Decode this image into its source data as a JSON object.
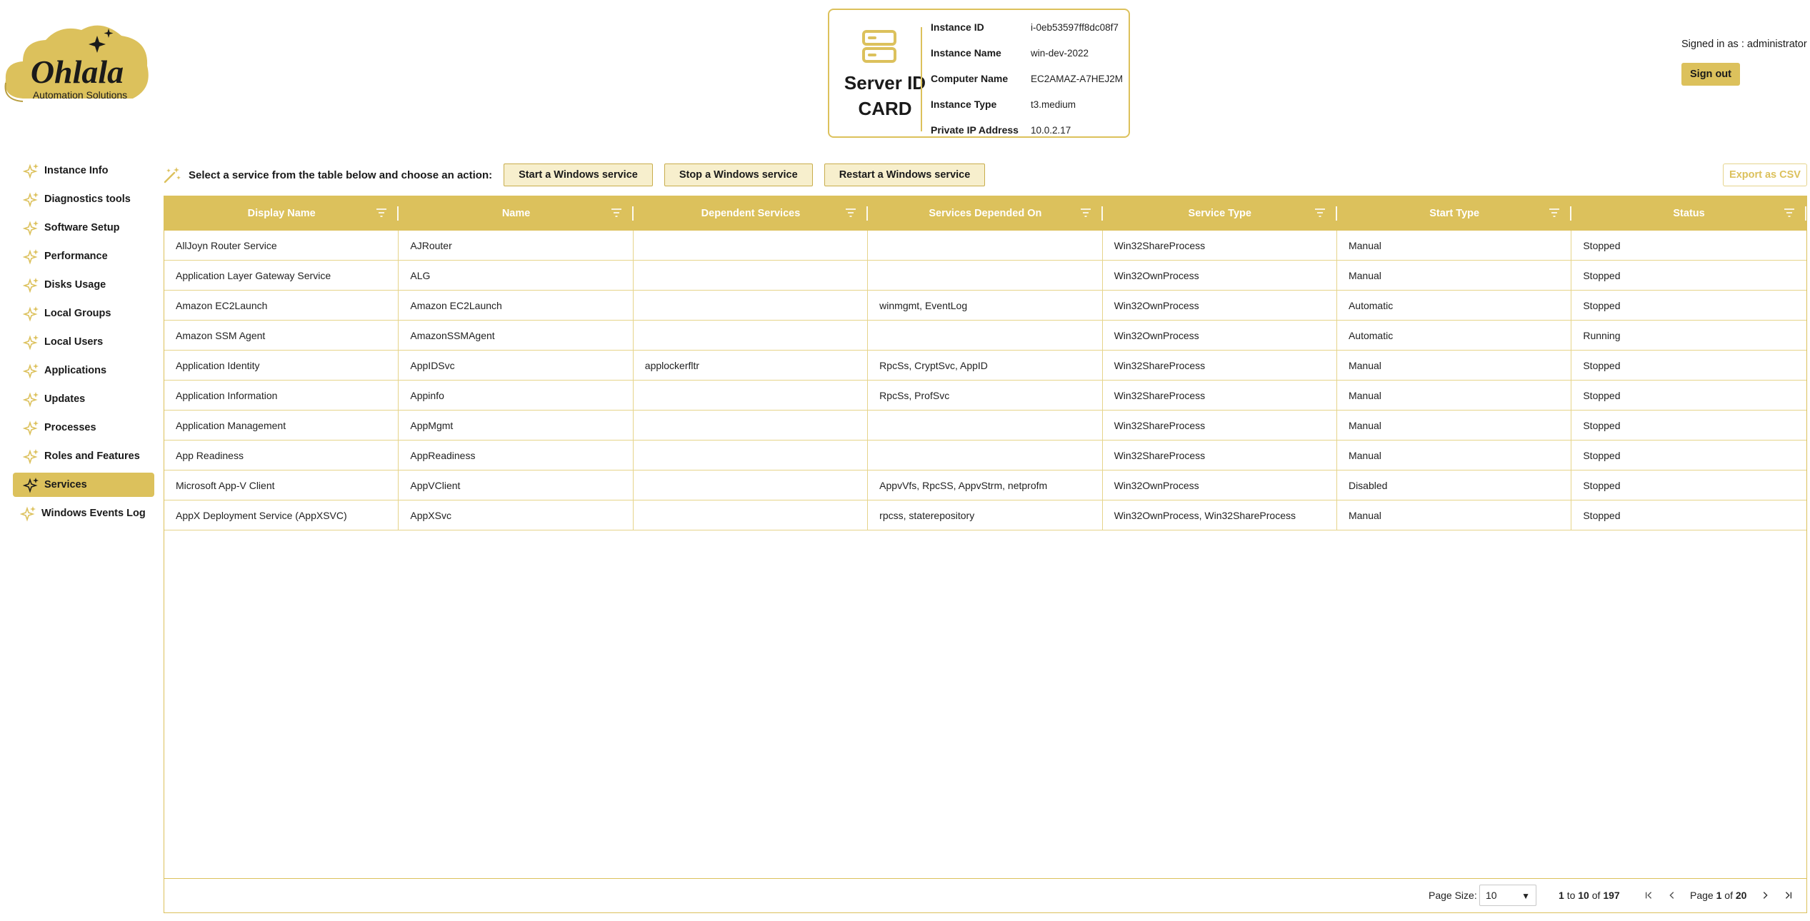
{
  "logo": {
    "brand": "Ohlala",
    "tagline": "Automation Solutions"
  },
  "id_card": {
    "title_line1": "Server ID",
    "title_line2": "CARD",
    "fields": [
      {
        "label": "Instance ID",
        "value": "i-0eb53597ff8dc08f7"
      },
      {
        "label": "Instance Name",
        "value": "win-dev-2022"
      },
      {
        "label": "Computer Name",
        "value": "EC2AMAZ-A7HEJ2M"
      },
      {
        "label": "Instance Type",
        "value": "t3.medium"
      },
      {
        "label": "Private IP Address",
        "value": "10.0.2.17"
      }
    ]
  },
  "user": {
    "signed_in": "Signed in as : administrator",
    "sign_out": "Sign out"
  },
  "sidebar": {
    "items": [
      {
        "label": "Instance Info"
      },
      {
        "label": "Diagnostics tools"
      },
      {
        "label": "Software Setup"
      },
      {
        "label": "Performance"
      },
      {
        "label": "Disks Usage"
      },
      {
        "label": "Local Groups"
      },
      {
        "label": "Local Users"
      },
      {
        "label": "Applications"
      },
      {
        "label": "Updates"
      },
      {
        "label": "Processes"
      },
      {
        "label": "Roles and Features"
      },
      {
        "label": "Services",
        "active": true
      },
      {
        "label": "Windows Events Log"
      }
    ]
  },
  "actions": {
    "prompt": "Select a service from the table below and choose an action:",
    "start": "Start a Windows service",
    "stop": "Stop a Windows service",
    "restart": "Restart a Windows service",
    "export": "Export as CSV"
  },
  "table": {
    "columns": [
      "Display Name",
      "Name",
      "Dependent Services",
      "Services Depended On",
      "Service Type",
      "Start Type",
      "Status"
    ],
    "rows": [
      [
        "AllJoyn Router Service",
        "AJRouter",
        "",
        "",
        "Win32ShareProcess",
        "Manual",
        "Stopped"
      ],
      [
        "Application Layer Gateway Service",
        "ALG",
        "",
        "",
        "Win32OwnProcess",
        "Manual",
        "Stopped"
      ],
      [
        "Amazon EC2Launch",
        "Amazon EC2Launch",
        "",
        "winmgmt, EventLog",
        "Win32OwnProcess",
        "Automatic",
        "Stopped"
      ],
      [
        "Amazon SSM Agent",
        "AmazonSSMAgent",
        "",
        "",
        "Win32OwnProcess",
        "Automatic",
        "Running"
      ],
      [
        "Application Identity",
        "AppIDSvc",
        "applockerfltr",
        "RpcSs, CryptSvc, AppID",
        "Win32ShareProcess",
        "Manual",
        "Stopped"
      ],
      [
        "Application Information",
        "Appinfo",
        "",
        "RpcSs, ProfSvc",
        "Win32ShareProcess",
        "Manual",
        "Stopped"
      ],
      [
        "Application Management",
        "AppMgmt",
        "",
        "",
        "Win32ShareProcess",
        "Manual",
        "Stopped"
      ],
      [
        "App Readiness",
        "AppReadiness",
        "",
        "",
        "Win32ShareProcess",
        "Manual",
        "Stopped"
      ],
      [
        "Microsoft App-V Client",
        "AppVClient",
        "",
        "AppvVfs, RpcSS, AppvStrm, netprofm",
        "Win32OwnProcess",
        "Disabled",
        "Stopped"
      ],
      [
        "AppX Deployment Service (AppXSVC)",
        "AppXSvc",
        "",
        "rpcss, staterepository",
        "Win32OwnProcess, Win32ShareProcess",
        "Manual",
        "Stopped"
      ]
    ]
  },
  "pagination": {
    "page_size_label": "Page Size:",
    "page_size": "10",
    "range_from": "1",
    "range_to_word": "to",
    "range_to": "10",
    "range_of_word": "of",
    "total": "197",
    "page_word": "Page",
    "page": "1",
    "page_of_word": "of",
    "page_total": "20"
  },
  "colors": {
    "accent": "#dcc15c",
    "button_bg": "#f7efcd"
  }
}
